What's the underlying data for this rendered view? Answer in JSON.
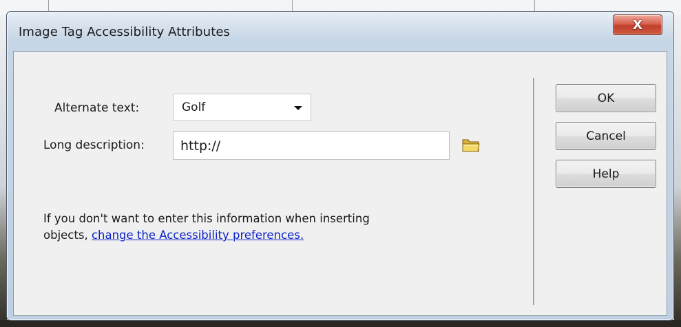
{
  "dialog": {
    "title": "Image Tag Accessibility Attributes",
    "close_label": "X"
  },
  "form": {
    "alternate_text": {
      "label": "Alternate text:",
      "value": "Golf"
    },
    "long_description": {
      "label": "Long description:",
      "value": "http://"
    },
    "browse_icon": "folder-icon"
  },
  "info": {
    "text_line1": "If you don't want to enter this information when inserting",
    "text_line2_prefix": "objects, ",
    "link_text": "change the Accessibility preferences."
  },
  "buttons": {
    "ok": "OK",
    "cancel": "Cancel",
    "help": "Help"
  },
  "colors": {
    "link": "#0b22c8",
    "close_button": "#c94a35",
    "client_background": "#f0f0f0"
  }
}
